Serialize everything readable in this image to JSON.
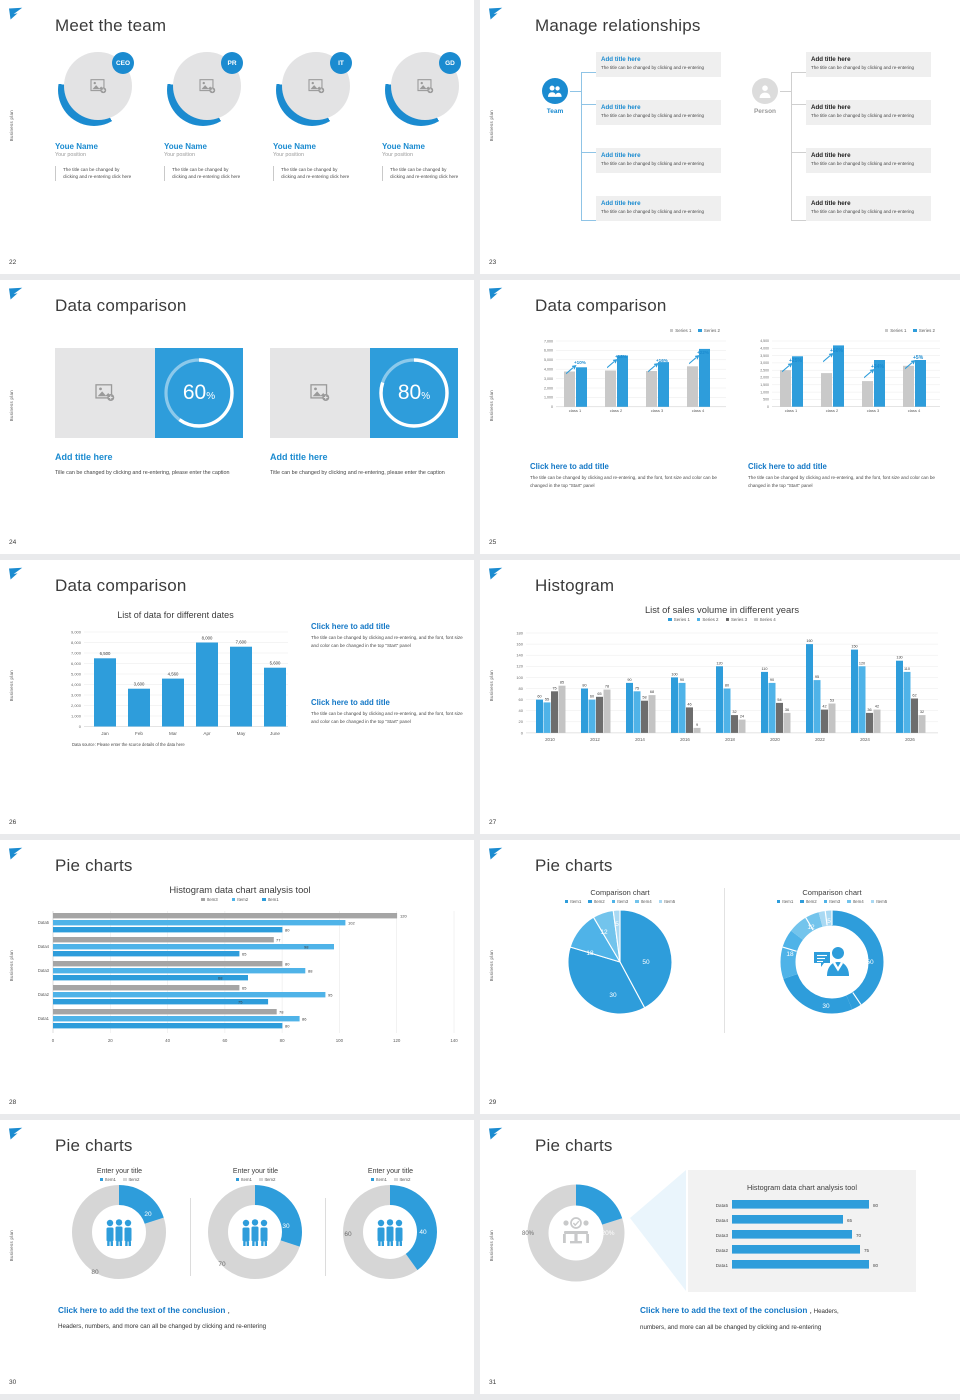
{
  "common": {
    "side_label": "Business plan",
    "logo_icon": "feather-logo-icon",
    "accent": "#1b8bd0",
    "accent_dark": "#1478c6",
    "grey": "#bfbfbf",
    "grey_dark": "#7b7b7b",
    "light_blue": "#4fb3e8"
  },
  "slides": [
    {
      "page": "22",
      "title": "Meet the team",
      "members": [
        {
          "badge": "CEO",
          "name": "Youe Name",
          "position": "Your position",
          "desc": "The title can be changed by clicking and re-entering click here",
          "image_icon": "add-image-icon"
        },
        {
          "badge": "PR",
          "name": "Youe Name",
          "position": "Your position",
          "desc": "The title can be changed by clicking and re-entering click here",
          "image_icon": "add-image-icon"
        },
        {
          "badge": "IT",
          "name": "Youe Name",
          "position": "Your position",
          "desc": "The title can be changed by clicking and re-entering click here",
          "image_icon": "add-image-icon"
        },
        {
          "badge": "GD",
          "name": "Youe Name",
          "position": "Your position",
          "desc": "The title can be changed by clicking and re-entering click here",
          "image_icon": "add-image-icon"
        }
      ]
    },
    {
      "page": "23",
      "title": "Manage relationships",
      "groups": [
        {
          "node_label": "Team",
          "node_icon": "team-people-icon",
          "node_color": "#1b8bd0",
          "label_color": "#1b8bd0",
          "title_color": "#1b8bd0",
          "cards": [
            {
              "title": "Add title here",
              "body": "The title can be changed by clicking and re-entering"
            },
            {
              "title": "Add title here",
              "body": "The title can be changed by clicking and re-entering"
            },
            {
              "title": "Add title here",
              "body": "The title can be changed by clicking and re-entering"
            },
            {
              "title": "Add title here",
              "body": "The title can be changed by clicking and re-entering"
            }
          ]
        },
        {
          "node_label": "Person",
          "node_icon": "single-person-icon",
          "node_color": "#dcdcdc",
          "label_color": "#9a9a9a",
          "title_color": "#222222",
          "cards": [
            {
              "title": "Add title here",
              "body": "The title can be changed by clicking and re-entering"
            },
            {
              "title": "Add title here",
              "body": "The title can be changed by clicking and re-entering"
            },
            {
              "title": "Add title here",
              "body": "The title can be changed by clicking and re-entering"
            },
            {
              "title": "Add title here",
              "body": "The title can be changed by clicking and re-entering"
            }
          ]
        }
      ]
    },
    {
      "page": "24",
      "title": "Data comparison",
      "cards": [
        {
          "percent": "60",
          "percent_sign": "%",
          "value": 60,
          "image_icon": "add-image-icon",
          "caption_title": "Add title here",
          "caption_body": "Tille can be changed by clicking and re-entering, please enter the caption"
        },
        {
          "percent": "80",
          "percent_sign": "%",
          "value": 80,
          "image_icon": "add-image-icon",
          "caption_title": "Add title here",
          "caption_body": "Title can be changed by clicking and re-entering, please enter the caption"
        }
      ]
    },
    {
      "page": "25",
      "title": "Data comparison",
      "captions": [
        {
          "title": "Click here to add title",
          "body": "The title can be changed by clicking and re-entering, and the font, font size and color can be changed in the top \"Start\" panel"
        },
        {
          "title": "Click here to add title",
          "body": "The title can be changed by clicking and re-entering, and the font, font size and color can be changed in the top \"Start\" panel"
        }
      ]
    },
    {
      "page": "26",
      "title": "Data comparison",
      "source_note": "Data source: Please enter the scurce details of the data here",
      "captions": [
        {
          "title": "Click here to add title",
          "body": "The title can be changed by clicking and re-entering, and the font, font size and color can be changed in the top \"Start\" panel"
        },
        {
          "title": "Click here to add title",
          "body": "The title can be changed by clicking and re-entering, and the font, font size and color can be changed in the top \"Start\" panel"
        }
      ]
    },
    {
      "page": "27",
      "title": "Histogram"
    },
    {
      "page": "28",
      "title": "Pie charts"
    },
    {
      "page": "29",
      "title": "Pie charts"
    },
    {
      "page": "30",
      "title": "Pie charts",
      "conclusion_head": "Click here to add the text of the conclusion",
      "conclusion_comma": " ,",
      "conclusion_body": "Headers, numbers, and more can all be changed by clicking and re-entering"
    },
    {
      "page": "31",
      "title": "Pie charts",
      "conclusion_head": "Click here to add the text of the conclusion",
      "conclusion_comma": " ,",
      "conclusion_tail": " Headers,",
      "conclusion_body": "numbers, and more can all be changed by clicking and re-entering"
    }
  ],
  "chart_data": [
    {
      "id": "s25-left",
      "type": "bar",
      "title": "",
      "categories": [
        "class 1",
        "class 2",
        "class 3",
        "class 4"
      ],
      "series": [
        {
          "name": "Series 1",
          "color": "#c9c9c9",
          "values": [
            3750,
            3850,
            3800,
            4300
          ]
        },
        {
          "name": "Series 2",
          "color": "#2e9ddb",
          "values": [
            4200,
            5450,
            4750,
            6150
          ]
        }
      ],
      "annotations": [
        "+10%",
        "+18%",
        "+16%",
        "+22%"
      ],
      "ylim": [
        0,
        7000
      ],
      "yticks": [
        "7,000",
        "6,000",
        "5,000",
        "4,000",
        "3,000",
        "2,000",
        "1,000",
        "0"
      ],
      "legend": "top-right",
      "grid": true,
      "xlabel": "",
      "ylabel": ""
    },
    {
      "id": "s25-right",
      "type": "bar",
      "title": "",
      "categories": [
        "class 1",
        "class 2",
        "class 3",
        "class 4"
      ],
      "series": [
        {
          "name": "Series 1",
          "color": "#c9c9c9",
          "values": [
            2500,
            2300,
            1750,
            2800
          ]
        },
        {
          "name": "Series 2",
          "color": "#2e9ddb",
          "values": [
            3450,
            4200,
            3200,
            3200
          ]
        }
      ],
      "annotations": [
        "+25%",
        "+50%",
        "+34%",
        "+5%"
      ],
      "ylim": [
        0,
        4500
      ],
      "yticks": [
        "4,500",
        "4,000",
        "3,500",
        "3,000",
        "2,500",
        "2,000",
        "1,500",
        "1,000",
        "500",
        "0"
      ],
      "legend": "top-right",
      "grid": true,
      "xlabel": "",
      "ylabel": ""
    },
    {
      "id": "s26",
      "type": "bar",
      "title": "List of data for different dates",
      "categories": [
        "Jan",
        "Feb",
        "Mar",
        "Apr",
        "May",
        "June"
      ],
      "values": [
        6500,
        3600,
        4560,
        8000,
        7600,
        5600
      ],
      "labels": [
        "6,500",
        "3,600",
        "4,560",
        "8,000",
        "7,600",
        "5,600"
      ],
      "color": "#2e9ddb",
      "ylim": [
        0,
        9000
      ],
      "yticks": [
        "9,000",
        "8,000",
        "7,000",
        "6,000",
        "5,000",
        "4,000",
        "3,000",
        "2,000",
        "1,000",
        "0"
      ],
      "grid": true,
      "legend": "none",
      "xlabel": "",
      "ylabel": ""
    },
    {
      "id": "s27",
      "type": "bar",
      "title": "List of sales volume in different years",
      "categories": [
        "2010",
        "2012",
        "2014",
        "2016",
        "2018",
        "2020",
        "2022",
        "2024",
        "2026"
      ],
      "series": [
        {
          "name": "Series 1",
          "color": "#2e9ddb",
          "values": [
            60,
            80,
            90,
            100,
            120,
            110,
            160,
            150,
            130
          ]
        },
        {
          "name": "Series 2",
          "color": "#4fb3e8",
          "values": [
            55,
            60,
            75,
            90,
            80,
            90,
            95,
            120,
            110
          ]
        },
        {
          "name": "Series 3",
          "color": "#6d6d6d",
          "values": [
            75,
            65,
            58,
            46,
            32,
            54,
            42,
            36,
            62
          ]
        },
        {
          "name": "Series 4",
          "color": "#c4c4c4",
          "values": [
            85,
            78,
            68,
            9,
            24,
            36,
            53,
            42,
            32
          ]
        }
      ],
      "ylim": [
        0,
        180
      ],
      "yticks": [
        "180",
        "160",
        "140",
        "120",
        "100",
        "80",
        "60",
        "40",
        "20",
        "0"
      ],
      "legend": "top-center",
      "grid": true,
      "xlabel": "",
      "ylabel": ""
    },
    {
      "id": "s28",
      "type": "bar",
      "orientation": "horizontal",
      "title": "Histogram data chart analysis tool",
      "categories": [
        "Data1",
        "Data2",
        "Data3",
        "Data4",
        "Data5"
      ],
      "series": [
        {
          "name": "Item3",
          "color": "#a5a5a5",
          "values": [
            78,
            65,
            80,
            77,
            120
          ]
        },
        {
          "name": "Item2",
          "color": "#4fb3e8",
          "values": [
            86,
            95,
            88,
            98,
            102
          ]
        },
        {
          "name": "Item1",
          "color": "#2e9ddb",
          "values": [
            80,
            75,
            68,
            65,
            80
          ]
        }
      ],
      "xlim": [
        0,
        140
      ],
      "xticks": [
        "0",
        "20",
        "40",
        "60",
        "80",
        "100",
        "120",
        "140"
      ],
      "legend": "top-center",
      "grid": true,
      "xlabel": "",
      "ylabel": ""
    },
    {
      "id": "s29-pie",
      "type": "pie",
      "title": "Comparison chart",
      "labels": [
        "Item1",
        "Item2",
        "Item3",
        "Item4",
        "Item5"
      ],
      "values": [
        50,
        30,
        18,
        12,
        5
      ],
      "colors": [
        "#2e9ddb",
        "#2e9ddb",
        "#4fb3e8",
        "#73c4ec",
        "#a9d9f3"
      ],
      "legend": "top-center"
    },
    {
      "id": "s29-donut",
      "type": "pie",
      "variant": "donut",
      "title": "Comparison chart",
      "labels": [
        "Item1",
        "Item2",
        "Item3",
        "Item4",
        "Item5"
      ],
      "values": [
        50,
        30,
        18,
        12,
        5
      ],
      "colors": [
        "#2e9ddb",
        "#2e9ddb",
        "#4fb3e8",
        "#73c4ec",
        "#a9d9f3"
      ],
      "center_icon": "presenter-person-icon",
      "legend": "top-center"
    },
    {
      "id": "s30-a",
      "type": "pie",
      "variant": "donut",
      "title": "Enter your title",
      "labels": [
        "Item1",
        "Item2"
      ],
      "values": [
        20,
        80
      ],
      "colors": [
        "#2e9ddb",
        "#d6d6d6"
      ],
      "center_icon": "three-people-icon",
      "legend": "top-center"
    },
    {
      "id": "s30-b",
      "type": "pie",
      "variant": "donut",
      "title": "Enter your title",
      "labels": [
        "Item1",
        "Item2"
      ],
      "values": [
        30,
        70
      ],
      "colors": [
        "#2e9ddb",
        "#d6d6d6"
      ],
      "center_icon": "three-people-icon",
      "legend": "top-center"
    },
    {
      "id": "s30-c",
      "type": "pie",
      "variant": "donut",
      "title": "Enter your title",
      "labels": [
        "Item1",
        "Item2"
      ],
      "values": [
        40,
        60
      ],
      "colors": [
        "#2e9ddb",
        "#d6d6d6"
      ],
      "center_icon": "three-people-icon",
      "legend": "top-center"
    },
    {
      "id": "s31-donut",
      "type": "pie",
      "variant": "donut",
      "title": "",
      "labels": [
        "20%",
        "80%"
      ],
      "values": [
        20,
        80
      ],
      "colors": [
        "#2e9ddb",
        "#d6d6d6"
      ],
      "center_icon": "team-meeting-icon",
      "legend": "none"
    },
    {
      "id": "s31-bars",
      "type": "bar",
      "orientation": "horizontal",
      "title": "Histogram data chart analysis tool",
      "categories": [
        "Data1",
        "Data2",
        "Data3",
        "Data4",
        "Data5"
      ],
      "values": [
        80,
        75,
        70,
        65,
        80
      ],
      "labels": [
        "80",
        "75",
        "70",
        "65",
        "80"
      ],
      "color": "#2e9ddb",
      "xlim": [
        0,
        95
      ],
      "legend": "none",
      "grid": false,
      "xlabel": "",
      "ylabel": ""
    }
  ]
}
